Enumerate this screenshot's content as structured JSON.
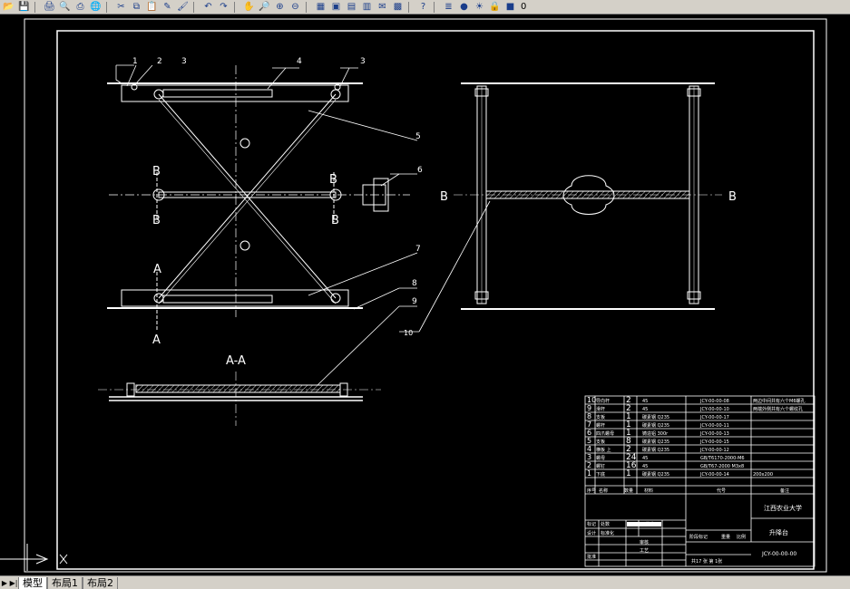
{
  "toolbar": {
    "icons": [
      "open-icon",
      "save-icon",
      "print-icon",
      "preview-icon",
      "publish-icon",
      "plot-icon",
      "cut-icon",
      "copy-icon",
      "paste-icon",
      "matchprop-icon",
      "brush-icon",
      "undo-icon",
      "redo-icon",
      "pan-icon",
      "zoom-realtime-icon",
      "zoom-window-icon",
      "zoom-previous-icon",
      "properties-icon",
      "designcenter-icon",
      "toolpalette-icon",
      "sheetset-icon",
      "markup-icon",
      "calculator-icon",
      "help-icon",
      "layers-icon",
      "bulb-icon",
      "sun-icon",
      "lock-icon",
      "color-icon"
    ],
    "layer_value": "0"
  },
  "tabs": [
    "模型",
    "布局1",
    "布局2"
  ],
  "drawing": {
    "labels": {
      "n1": "1",
      "n2": "2",
      "n3": "3",
      "n4": "4",
      "n3b": "3",
      "n5": "5",
      "n6": "6",
      "n7": "7",
      "n8": "8",
      "n9": "9",
      "n10": "10",
      "B1": "B",
      "B2": "B",
      "B3": "B",
      "B4": "B",
      "A1": "A",
      "A2": "A",
      "AA": "A-A",
      "BL": "B",
      "BR": "B"
    }
  },
  "bom": {
    "rows": [
      {
        "no": "10",
        "name": "导向杆",
        "qty": "2",
        "mat": "45",
        "code": "JCY-00-00-08",
        "note": "两边中间共有六个M6螺孔"
      },
      {
        "no": "9",
        "name": "滑杆",
        "qty": "2",
        "mat": "45",
        "code": "JCY-00-00-10",
        "note": "两端外侧共有六个螺纹孔"
      },
      {
        "no": "8",
        "name": "支板",
        "qty": "1",
        "mat": "碳素钢 Q235",
        "code": "JCY-00-00-17",
        "note": ""
      },
      {
        "no": "7",
        "name": "螺杆",
        "qty": "1",
        "mat": "碳素钢 Q235",
        "code": "JCY-00-00-11",
        "note": ""
      },
      {
        "no": "6",
        "name": "四爪螺母",
        "qty": "1",
        "mat": "铸造铝 300r",
        "code": "JCY-00-00-13",
        "note": ""
      },
      {
        "no": "5",
        "name": "支板",
        "qty": "8",
        "mat": "碳素钢 Q235",
        "code": "JCY-00-00-15",
        "note": ""
      },
      {
        "no": "4",
        "name": "横板 上",
        "qty": "2",
        "mat": "碳素钢 Q235",
        "code": "JCY-00-00-12",
        "note": ""
      },
      {
        "no": "3",
        "name": "螺母",
        "qty": "24",
        "mat": "45",
        "code": "GB/T6170-2000-M6",
        "note": ""
      },
      {
        "no": "2",
        "name": "螺钉",
        "qty": "16",
        "mat": "45",
        "code": "GB/T67-2000 M3x8",
        "note": ""
      },
      {
        "no": "1",
        "name": "下底",
        "qty": "1",
        "mat": "碳素钢 Q235",
        "code": "JCY-00-00-14",
        "note": "200x200"
      }
    ],
    "header": {
      "no": "序号",
      "name": "名称",
      "qty": "数量",
      "mat": "材料",
      "code": "代号",
      "note": "备注"
    },
    "school": "江西农业大学",
    "title": "升降台",
    "drawing_no": "JCY-00-00-00",
    "sheet_info": "共17  张  第  1张",
    "labels": {
      "design": "设计",
      "check": "审核",
      "process": "工艺",
      "std": "标准化",
      "approve": "批准",
      "mark": "标记",
      "count": "处数",
      "zone": "分区",
      "doc": "更改文件号",
      "sign": "签名",
      "date": "年月日",
      "stage": "阶段标记",
      "weight": "重量",
      "scale": "比例"
    }
  },
  "colors": {
    "bg": "#000000",
    "line": "#ffffff",
    "toolbar": "#d4d0c8"
  }
}
